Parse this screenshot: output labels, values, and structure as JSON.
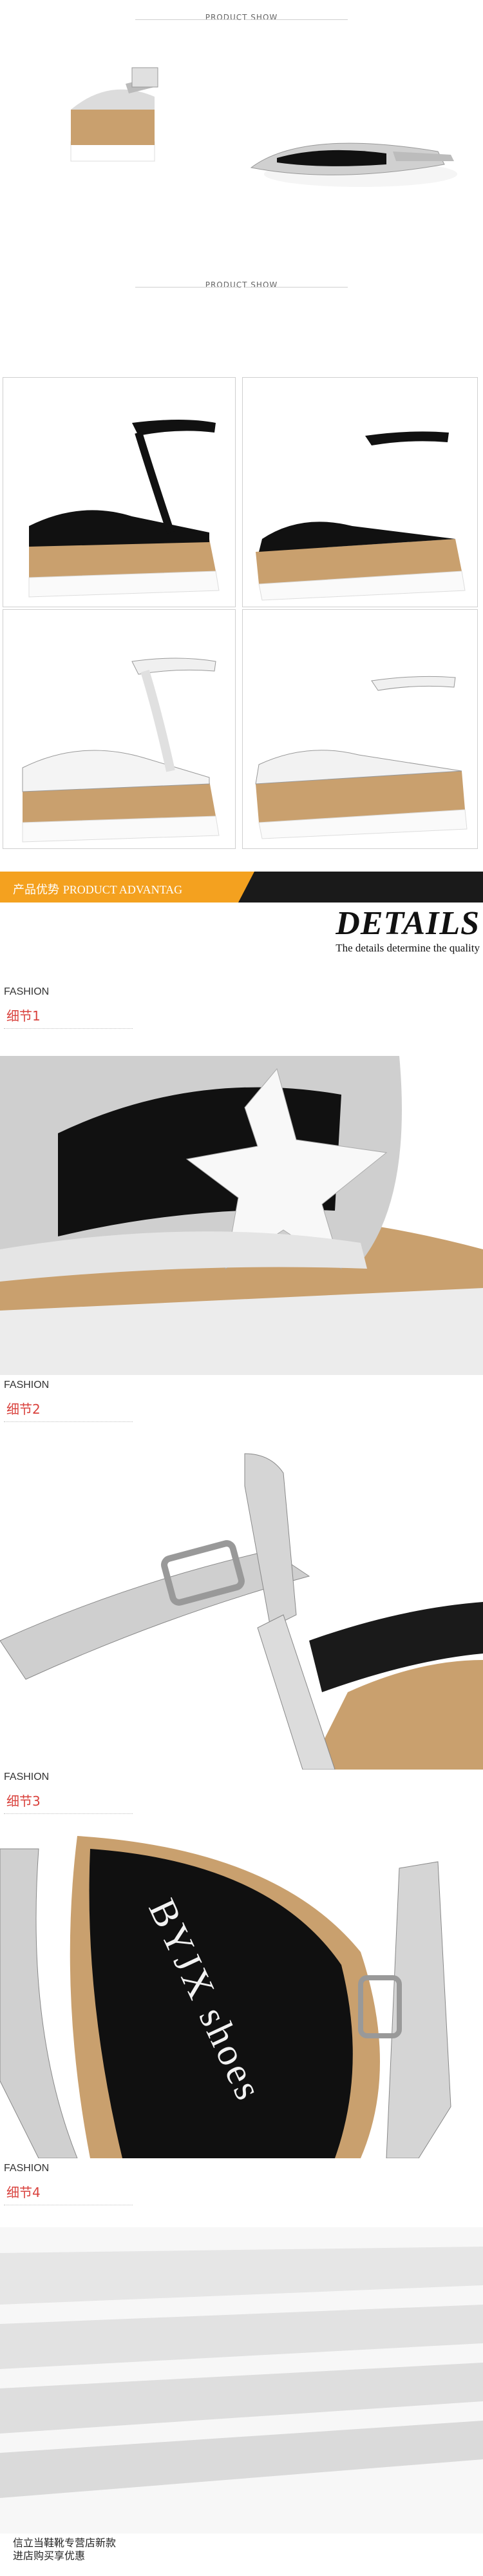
{
  "product_show_1": {
    "title": "PRODUCT SHOW",
    "subtitle": ""
  },
  "product_show_2": {
    "title": "PRODUCT SHOW",
    "subtitle": ""
  },
  "advantage_bar": {
    "cn": "产品优势",
    "en": "PRODUCT ADVANTAG"
  },
  "details": {
    "title": "DETAILS",
    "subtitle": "The details determine the quality"
  },
  "details_blocks": [
    {
      "fashion": "FASHION",
      "label": "细节1"
    },
    {
      "fashion": "FASHION",
      "label": "细节2"
    },
    {
      "fashion": "FASHION",
      "label": "细节3"
    },
    {
      "fashion": "FASHION",
      "label": "细节4"
    }
  ],
  "insole_brand": "BYJX shoes",
  "footer": {
    "line1": "信立当鞋靴专营店新款",
    "line2": "进店购买享优惠"
  },
  "colors": {
    "accent_orange": "#f4a11f",
    "detail_red": "#d9423d",
    "wood": "#c9a06e",
    "silver": "#c8c8c8"
  }
}
